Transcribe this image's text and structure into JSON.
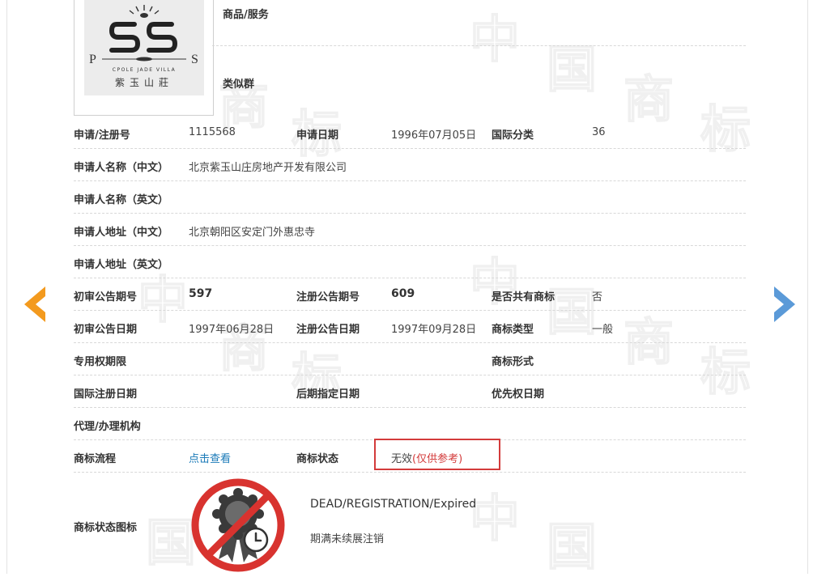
{
  "watermark": {
    "char1": "中",
    "char2": "国",
    "char3": "商",
    "char4": "标"
  },
  "logo": {
    "letter_left": "P",
    "letter_right": "S",
    "subtitle": "CPOLE JADE VILLA",
    "chinese": "紫玉山莊"
  },
  "goods_services": {
    "label": "商品/服务",
    "value": ""
  },
  "similar_group": {
    "label": "类似群",
    "value": ""
  },
  "registration_no": {
    "label": "申请/注册号",
    "value": "1115568"
  },
  "application_date": {
    "label": "申请日期",
    "value": "1996年07月05日"
  },
  "intl_class": {
    "label": "国际分类",
    "value": "36"
  },
  "applicant_cn": {
    "label": "申请人名称（中文）",
    "value": "北京紫玉山庄房地产开发有限公司"
  },
  "applicant_en": {
    "label": "申请人名称（英文）",
    "value": ""
  },
  "address_cn": {
    "label": "申请人地址（中文）",
    "value": "北京朝阳区安定门外惠忠寺"
  },
  "address_en": {
    "label": "申请人地址（英文）",
    "value": ""
  },
  "prelim_issue_no": {
    "label": "初审公告期号",
    "value": "597"
  },
  "reg_issue_no": {
    "label": "注册公告期号",
    "value": "609"
  },
  "shared_mark": {
    "label": "是否共有商标",
    "value": "否"
  },
  "prelim_date": {
    "label": "初审公告日期",
    "value": "1997年06月28日"
  },
  "reg_date": {
    "label": "注册公告日期",
    "value": "1997年09月28日"
  },
  "mark_type": {
    "label": "商标类型",
    "value": "一般"
  },
  "exclusive_term": {
    "label": "专用权期限",
    "value": ""
  },
  "mark_form": {
    "label": "商标形式",
    "value": ""
  },
  "intl_reg_date": {
    "label": "国际注册日期",
    "value": ""
  },
  "later_designation_date": {
    "label": "后期指定日期",
    "value": ""
  },
  "priority_date": {
    "label": "优先权日期",
    "value": ""
  },
  "agency": {
    "label": "代理/办理机构",
    "value": ""
  },
  "process": {
    "label": "商标流程",
    "link": "点击查看"
  },
  "status": {
    "label": "商标状态",
    "value": "无效",
    "note": "(仅供参考)"
  },
  "status_icon": {
    "label": "商标状态图标",
    "english": "DEAD/REGISTRATION/Expired",
    "chinese": "期满未续展注销"
  },
  "nav": {
    "prev": "prev-arrow",
    "next": "next-arrow"
  },
  "colors": {
    "accent_orange": "#f39a1e",
    "accent_blue": "#5b9ad8",
    "status_red": "#d33b3b",
    "link": "#1a7ab8"
  }
}
